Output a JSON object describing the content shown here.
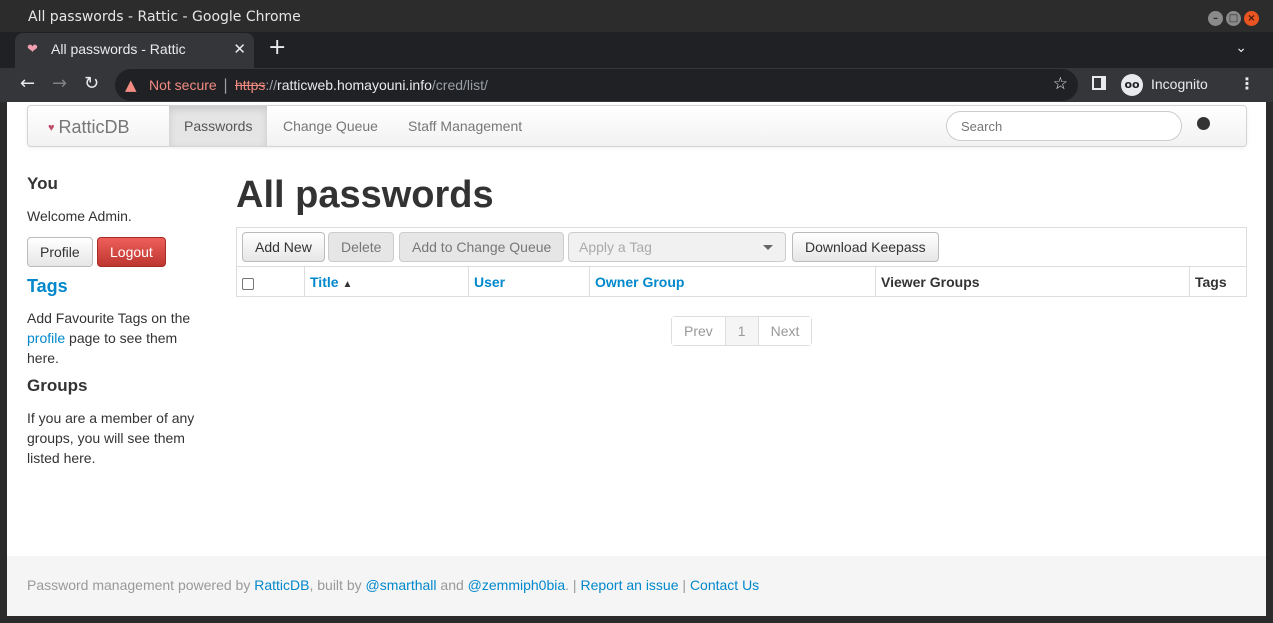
{
  "window": {
    "title": "All passwords - Rattic - Google Chrome"
  },
  "tab": {
    "title": "All passwords - Rattic"
  },
  "toolbar": {
    "not_secure": "Not secure",
    "url_scheme": "https",
    "url_sep": "://",
    "url_host": "ratticweb.homayouni.info",
    "url_path": "/cred/list/",
    "incognito": "Incognito"
  },
  "navbar": {
    "brand": "RatticDB",
    "items": [
      "Passwords",
      "Change Queue",
      "Staff Management"
    ],
    "search_placeholder": "Search"
  },
  "sidebar": {
    "you_heading": "You",
    "welcome": "Welcome Admin.",
    "profile_button": "Profile",
    "logout_button": "Logout",
    "tags_heading": "Tags",
    "tags_text_before": "Add Favourite Tags on the ",
    "tags_link": "profile",
    "tags_text_after": " page to see them here.",
    "groups_heading": "Groups",
    "groups_text": "If you are a member of any groups, you will see them listed here."
  },
  "main": {
    "title": "All passwords",
    "actions": {
      "add_new": "Add New",
      "delete": "Delete",
      "add_to_queue": "Add to Change Queue",
      "apply_tag": "Apply a Tag",
      "download_keepass": "Download Keepass"
    },
    "columns": [
      "Title",
      "User",
      "Owner Group",
      "Viewer Groups",
      "Tags"
    ],
    "pagination": {
      "prev": "Prev",
      "page": "1",
      "next": "Next"
    }
  },
  "footer": {
    "text1": "Password management powered by ",
    "link_rattic": "RatticDB",
    "text2": ", built by ",
    "link_smarthall": "@smarthall",
    "text3": " and ",
    "link_zemm": "@zemmiph0bia",
    "text4": ". | ",
    "link_issue": "Report an issue",
    "text5": " | ",
    "link_contact": "Contact Us"
  }
}
